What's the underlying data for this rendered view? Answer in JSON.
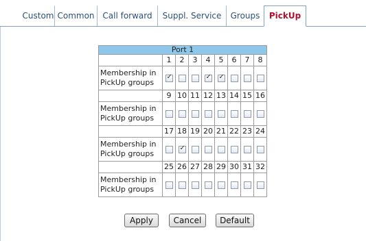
{
  "tabs": [
    {
      "label": "Custom",
      "active": false
    },
    {
      "label": "Common",
      "active": false
    },
    {
      "label": "Call forward",
      "active": false
    },
    {
      "label": "Suppl. Service",
      "active": false
    },
    {
      "label": "Groups",
      "active": false
    },
    {
      "label": "PickUp",
      "active": true
    }
  ],
  "port_title": "Port 1",
  "row_label_lines": [
    "Membership in",
    "PickUp groups"
  ],
  "groups": [
    {
      "numbers": [
        "1",
        "2",
        "3",
        "4",
        "5",
        "6",
        "7",
        "8"
      ],
      "checked": [
        true,
        false,
        false,
        true,
        true,
        false,
        false,
        false
      ]
    },
    {
      "numbers": [
        "9",
        "10",
        "11",
        "12",
        "13",
        "14",
        "15",
        "16"
      ],
      "checked": [
        false,
        false,
        false,
        false,
        false,
        false,
        false,
        false
      ]
    },
    {
      "numbers": [
        "17",
        "18",
        "19",
        "20",
        "21",
        "22",
        "23",
        "24"
      ],
      "checked": [
        false,
        true,
        false,
        false,
        false,
        false,
        false,
        false
      ]
    },
    {
      "numbers": [
        "25",
        "26",
        "27",
        "28",
        "29",
        "30",
        "31",
        "32"
      ],
      "checked": [
        false,
        false,
        false,
        false,
        false,
        false,
        false,
        false
      ]
    }
  ],
  "buttons": {
    "apply": "Apply",
    "cancel": "Cancel",
    "default": "Default"
  },
  "colors": {
    "active_tab_text": "#b0122e",
    "tab_text": "#2b4f7a",
    "port_header_bg": "#8ec7ec"
  }
}
